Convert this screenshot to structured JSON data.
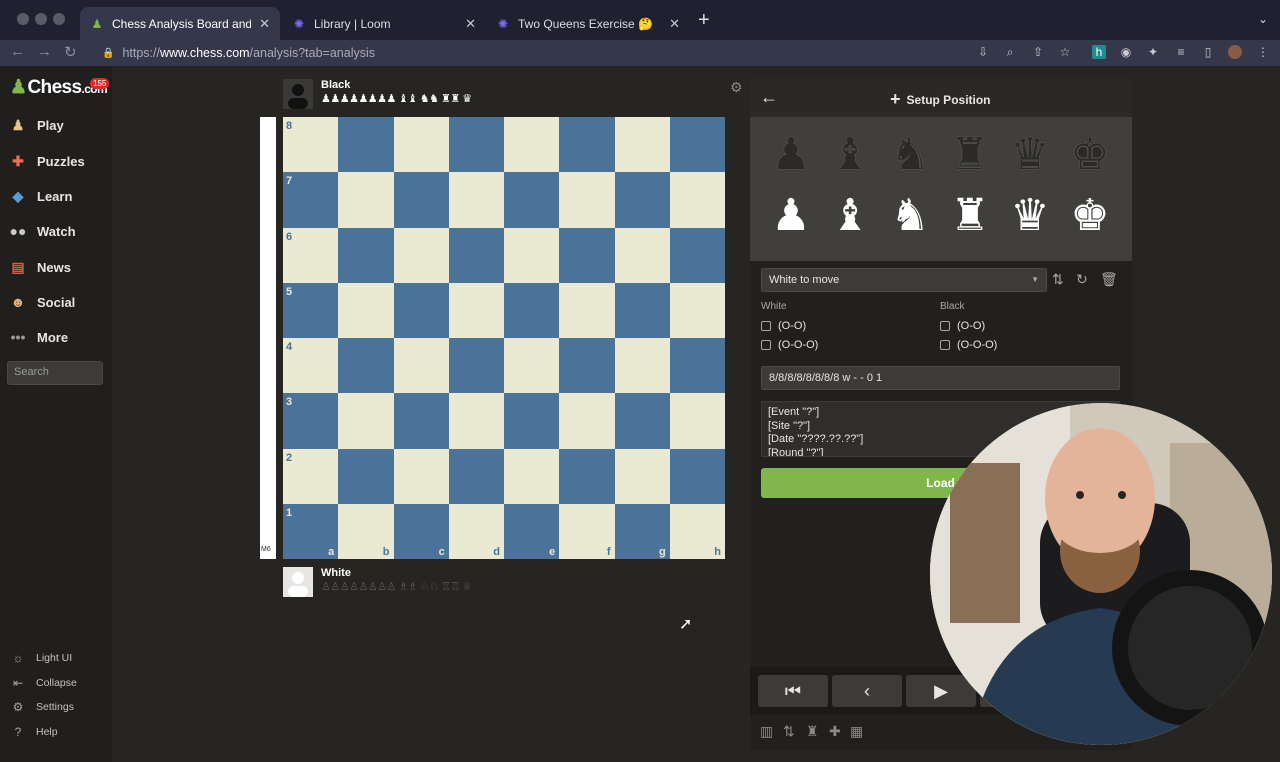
{
  "browser": {
    "tabs": [
      {
        "label": "Chess Analysis Board and PGN",
        "icon": "chess-pawn-icon",
        "active": true
      },
      {
        "label": "Library | Loom",
        "icon": "loom-icon",
        "active": false
      },
      {
        "label": "Two Queens Exercise 🤔",
        "icon": "loom-icon",
        "active": false
      }
    ],
    "url_scheme": "https://",
    "url_host": "www.chess.com",
    "url_path": "/analysis?tab=analysis"
  },
  "sidebar": {
    "logo_text": "Chess",
    "logo_suffix": ".com",
    "logo_badge": "155",
    "nav": [
      {
        "label": "Play",
        "icon": "play-pawn-icon",
        "color": "#e8c48b"
      },
      {
        "label": "Puzzles",
        "icon": "puzzle-icon",
        "color": "#e96f4d"
      },
      {
        "label": "Learn",
        "icon": "learn-cap-icon",
        "color": "#5a9bd5"
      },
      {
        "label": "Watch",
        "icon": "binoculars-icon",
        "color": "#c9c9c9"
      },
      {
        "label": "News",
        "icon": "news-icon",
        "color": "#d75d4a"
      },
      {
        "label": "Social",
        "icon": "social-icon",
        "color": "#e0b07a"
      },
      {
        "label": "More",
        "icon": "more-dots-icon",
        "color": "#9b9a98"
      }
    ],
    "search_placeholder": "Search",
    "bottom": [
      {
        "label": "Light UI",
        "icon": "sun-icon"
      },
      {
        "label": "Collapse",
        "icon": "collapse-icon"
      },
      {
        "label": "Settings",
        "icon": "gear-icon"
      },
      {
        "label": "Help",
        "icon": "help-icon"
      }
    ]
  },
  "board": {
    "black_player": "Black",
    "white_player": "White",
    "black_captured": "♟♟♟♟♟♟♟♟ ♝♝ ♞♞ ♜♜ ♛",
    "white_captured": "♙♙♙♙♙♙♙♙ ♗♗ ♘♘ ♖♖ ♕",
    "eval": "M6",
    "ranks": [
      "8",
      "7",
      "6",
      "5",
      "4",
      "3",
      "2",
      "1"
    ],
    "files": [
      "a",
      "b",
      "c",
      "d",
      "e",
      "f",
      "g",
      "h"
    ],
    "light_color": "#eae9d2",
    "dark_color": "#4b7399"
  },
  "panel": {
    "title": "Setup Position",
    "black_pieces": [
      "♟",
      "♝",
      "♞",
      "♜",
      "♛",
      "♚"
    ],
    "white_pieces": [
      "♟",
      "♝",
      "♞",
      "♜",
      "♛",
      "♚"
    ],
    "to_move": "White to move",
    "white_label": "White",
    "black_label": "Black",
    "castle_short": "(O-O)",
    "castle_long": "(O-O-O)",
    "fen": "8/8/8/8/8/8/8/8 w - - 0 1",
    "pgn_lines": [
      "[Event \"?\"]",
      "[Site \"?\"]",
      "[Date \"????.??.??\"]",
      "[Round \"?\"]"
    ],
    "load_label": "Load",
    "load_color": "#81b64c"
  }
}
